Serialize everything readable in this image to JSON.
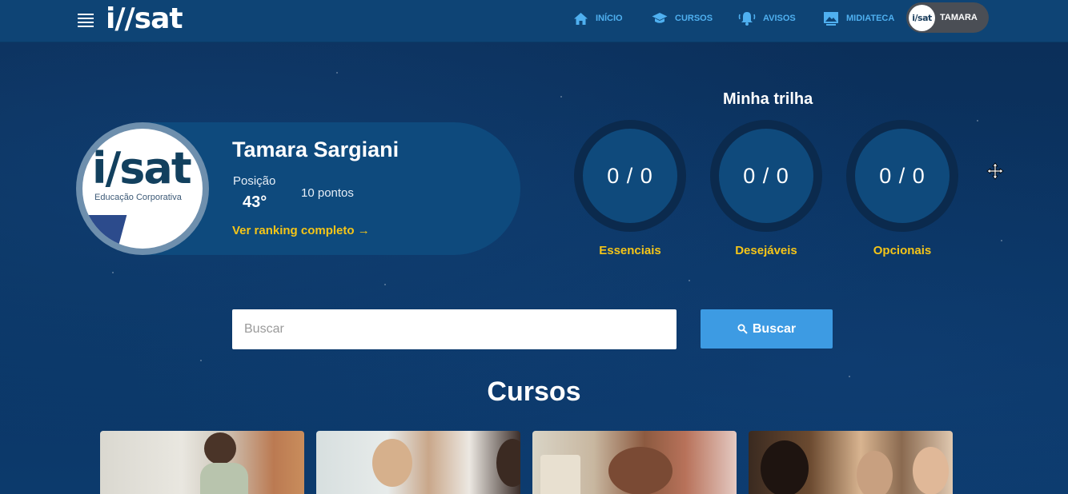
{
  "header": {
    "logo_text": "i//sat",
    "nav": [
      {
        "label": "INÍCIO",
        "icon": "home-icon"
      },
      {
        "label": "CURSOS",
        "icon": "graduation-cap-icon"
      },
      {
        "label": "AVISOS",
        "icon": "bell-icon"
      },
      {
        "label": "MIDIATECA",
        "icon": "image-icon"
      }
    ],
    "user": {
      "avatar_text": "i/sat",
      "name": "TAMARA"
    },
    "accent_color": "#4fb0f0"
  },
  "profile": {
    "avatar_logo": "i/sat",
    "avatar_subtitle": "Educação Corporativa",
    "name": "Tamara Sargiani",
    "position_label": "Posição",
    "position_value": "43°",
    "points": "10 pontos",
    "ranking_link": "Ver ranking completo →"
  },
  "trilha": {
    "title": "Minha trilha",
    "items": [
      {
        "value": "0 / 0",
        "label": "Essenciais"
      },
      {
        "value": "0 / 0",
        "label": "Desejáveis"
      },
      {
        "value": "0 / 0",
        "label": "Opcionais"
      }
    ],
    "label_color": "#f5c518"
  },
  "search": {
    "placeholder": "Buscar",
    "value": "",
    "button_label": "Buscar"
  },
  "courses": {
    "title": "Cursos",
    "cards": [
      "course-1",
      "course-2",
      "course-3",
      "course-4"
    ]
  }
}
